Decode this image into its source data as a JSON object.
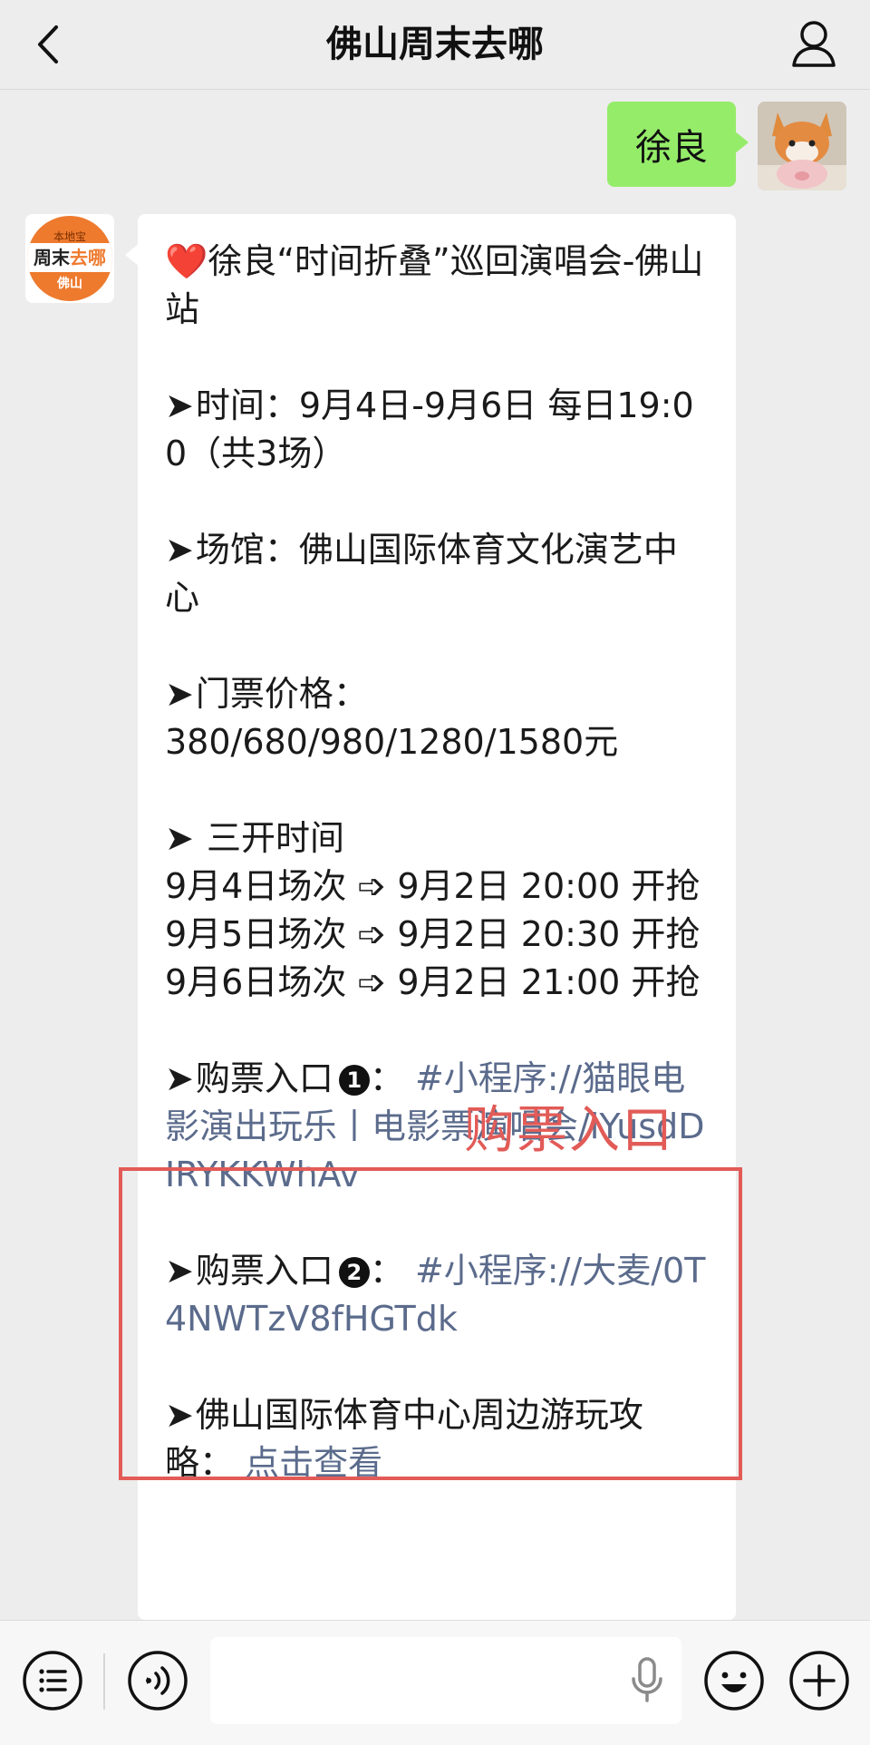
{
  "header": {
    "title": "佛山周末去哪",
    "back_icon": "chevron-left-icon",
    "profile_icon": "person-icon"
  },
  "chat": {
    "user_message": "徐良",
    "bot_logo": {
      "top": "本地宝",
      "left": "周末",
      "right": "去哪",
      "bottom": "佛山"
    },
    "bot_message": {
      "heart": "❤️",
      "title": "徐良“时间折叠”巡回演唱会-佛山站",
      "arrow": "➤",
      "time": "时间：9月4日-9月6日 每日19:00（共3场）",
      "venue": "场馆：佛山国际体育文化演艺中心",
      "price_label": "门票价格：",
      "price_value": "380/680/980/1280/1580元",
      "sale_title": "三开时间",
      "sale_1": "9月4日场次 ➩ 9月2日 20:00 开抢",
      "sale_2": "9月5日场次 ➩ 9月2日 20:30 开抢",
      "sale_3": "9月6日场次 ➩ 9月2日 21:00 开抢",
      "entry_label": "购票入口",
      "entry_1_num": "1",
      "entry_1_link": "#小程序://猫眼电影演出玩乐丨电影票演唱会/lYusdDIRYKKWhAv",
      "entry_2_num": "2",
      "entry_2_link": "#小程序://大麦/0T4NWTzV8fHGTdk",
      "colon": "：",
      "guide_text": "佛山国际体育中心周边游玩攻略：",
      "guide_link": "点击查看"
    },
    "overlay_label": "购票入口"
  },
  "input_bar": {
    "menu_icon": "list-menu-icon",
    "voice_icon": "voice-toggle-icon",
    "mic_icon": "microphone-icon",
    "emoji_icon": "emoji-icon",
    "plus_icon": "plus-icon"
  },
  "colors": {
    "background": "#ededed",
    "user_bubble": "#95ec69",
    "link": "#5b6b8c",
    "annotation": "#e25b57",
    "logo_orange": "#ee7a2e"
  }
}
